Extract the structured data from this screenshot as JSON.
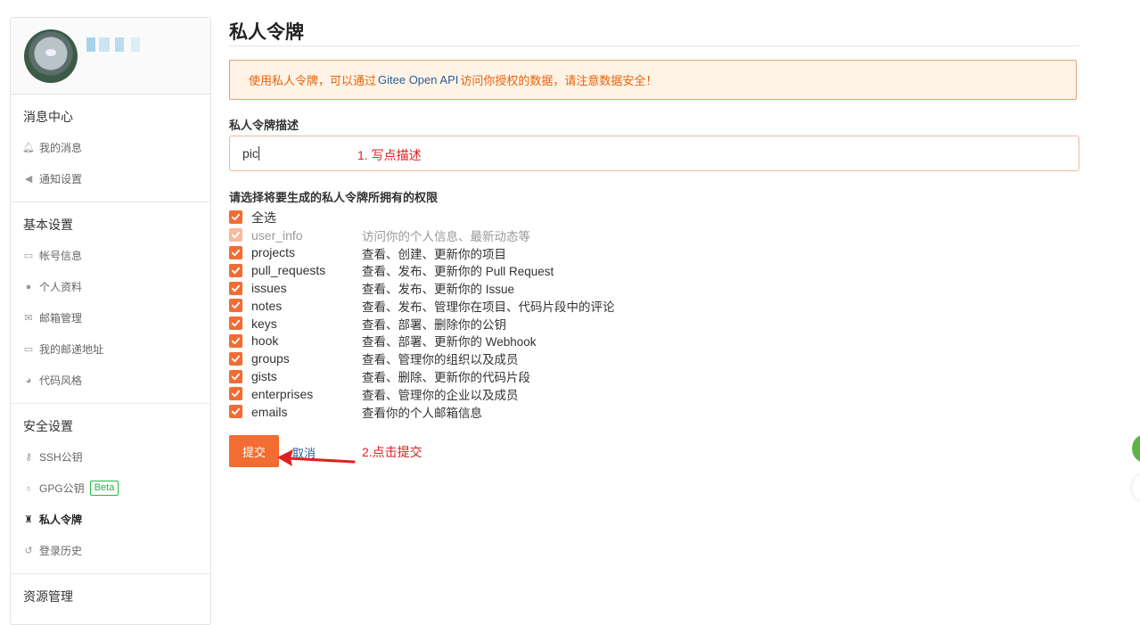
{
  "sidebar": {
    "sections": [
      {
        "title": "消息中心",
        "items": [
          {
            "label": "我的消息",
            "icon": "bell-icon"
          },
          {
            "label": "通知设置",
            "icon": "volume-icon"
          }
        ]
      },
      {
        "title": "基本设置",
        "items": [
          {
            "label": "帐号信息",
            "icon": "id-card-icon"
          },
          {
            "label": "个人资料",
            "icon": "user-icon"
          },
          {
            "label": "邮箱管理",
            "icon": "envelope-icon"
          },
          {
            "label": "我的邮递地址",
            "icon": "address-card-icon"
          },
          {
            "label": "代码风格",
            "icon": "palette-icon"
          }
        ]
      },
      {
        "title": "安全设置",
        "items": [
          {
            "label": "SSH公钥",
            "icon": "key-icon"
          },
          {
            "label": "GPG公钥",
            "icon": "gpg-icon",
            "badge": "Beta"
          },
          {
            "label": "私人令牌",
            "icon": "spy-icon",
            "active": true
          },
          {
            "label": "登录历史",
            "icon": "history-icon"
          }
        ]
      },
      {
        "title": "资源管理",
        "items": []
      }
    ]
  },
  "main": {
    "title": "私人令牌",
    "notice": {
      "before": "使用私人令牌，可以通过",
      "link": "Gitee Open API",
      "after": "访问你授权的数据，请注意数据安全！"
    },
    "description_label": "私人令牌描述",
    "description_value": "pic",
    "annotation_1": "1. 写点描述",
    "permissions_label": "请选择将要生成的私人令牌所拥有的权限",
    "permissions": [
      {
        "name": "全选",
        "desc": "",
        "checked": true,
        "disabled": false
      },
      {
        "name": "user_info",
        "desc": "访问你的个人信息、最新动态等",
        "checked": true,
        "disabled": true
      },
      {
        "name": "projects",
        "desc": "查看、创建、更新你的项目",
        "checked": true,
        "disabled": false
      },
      {
        "name": "pull_requests",
        "desc": "查看、发布、更新你的 Pull Request",
        "checked": true,
        "disabled": false
      },
      {
        "name": "issues",
        "desc": "查看、发布、更新你的 Issue",
        "checked": true,
        "disabled": false
      },
      {
        "name": "notes",
        "desc": "查看、发布、管理你在项目、代码片段中的评论",
        "checked": true,
        "disabled": false
      },
      {
        "name": "keys",
        "desc": "查看、部署、删除你的公钥",
        "checked": true,
        "disabled": false
      },
      {
        "name": "hook",
        "desc": "查看、部署、更新你的 Webhook",
        "checked": true,
        "disabled": false
      },
      {
        "name": "groups",
        "desc": "查看、管理你的组织以及成员",
        "checked": true,
        "disabled": false
      },
      {
        "name": "gists",
        "desc": "查看、删除、更新你的代码片段",
        "checked": true,
        "disabled": false
      },
      {
        "name": "enterprises",
        "desc": "查看、管理你的企业以及成员",
        "checked": true,
        "disabled": false
      },
      {
        "name": "emails",
        "desc": "查看你的个人邮箱信息",
        "checked": true,
        "disabled": false
      }
    ],
    "submit_label": "提交",
    "cancel_label": "取消",
    "annotation_2": "2.点击提交"
  },
  "colors": {
    "accent": "#f36c32",
    "link": "#2d5d9c",
    "annotation": "#e02020",
    "notice_bg": "#fff3e6",
    "notice_text": "#e8630a",
    "beta": "#21ba45"
  }
}
